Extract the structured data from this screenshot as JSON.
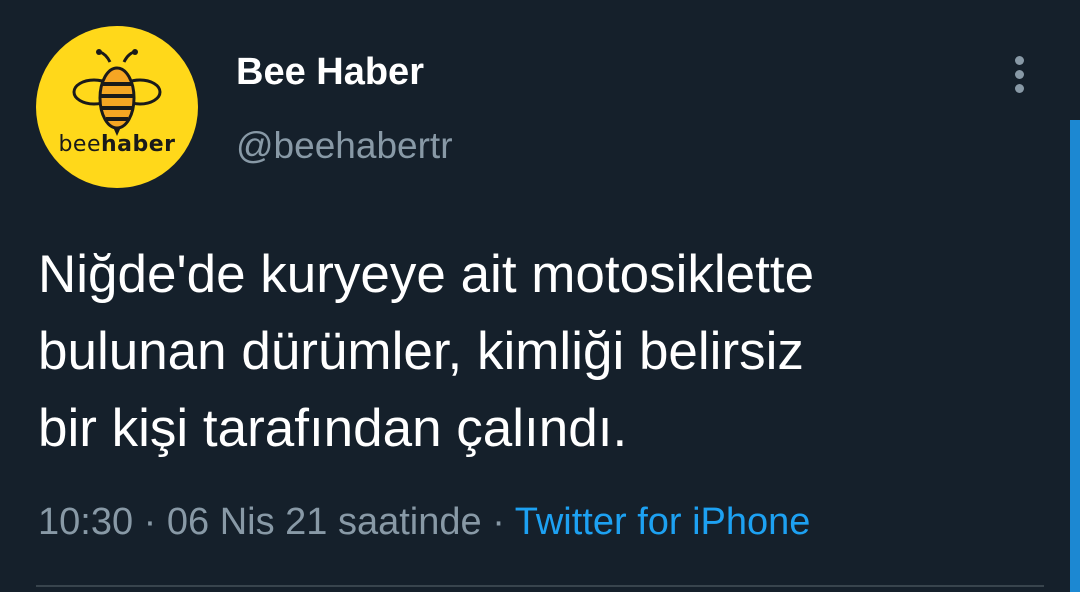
{
  "tweet": {
    "avatar": {
      "icon": "bee-logo-icon",
      "logo_text_bee": "bee",
      "logo_text_haber": "haber",
      "background_color": "#ffd81a"
    },
    "display_name": "Bee Haber",
    "handle": "@beehabertr",
    "more_icon": "vertical-ellipsis-icon",
    "text": "Niğde'de kuryeye ait motosiklette\nbulunan dürümler, kimliği belirsiz\nbir kişi tarafından çalındı.",
    "time": "10:30",
    "separator1": " · ",
    "date": "06 Nis 21 saatinde",
    "separator2": " · ",
    "source": "Twitter for iPhone"
  },
  "colors": {
    "background": "#15202b",
    "primary_text": "#ffffff",
    "secondary_text": "#8899a6",
    "link": "#1da1f2",
    "divider": "#38444d"
  }
}
